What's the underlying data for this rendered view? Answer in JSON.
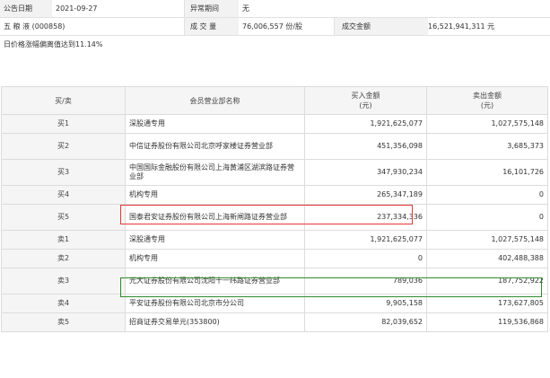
{
  "info": {
    "announce_date_label": "公告日期",
    "announce_date": "2021-09-27",
    "abnormal_period_label": "异常期间",
    "abnormal_period": "无",
    "stock_name": "五 粮 液 (000858)",
    "volume_label": "成 交 量",
    "volume": "76,006,557 份/股",
    "turnover_label": "成交金额",
    "turnover": "16,521,941,311 元",
    "reason": "日价格涨幅偏离值达到11.14%"
  },
  "table": {
    "headers": {
      "direction": "买/卖",
      "member": "会员营业部名称",
      "buy": "买入金额\n(元)",
      "sell": "卖出金额\n(元)"
    },
    "rows": [
      {
        "direction": "买1",
        "member": "深股通专用",
        "buy": "1,921,625,077",
        "sell": "1,027,575,148"
      },
      {
        "direction": "买2",
        "member": "中信证券股份有限公司北京呼家楼证券营业部",
        "buy": "451,356,098",
        "sell": "3,685,373"
      },
      {
        "direction": "买3",
        "member": "中国国际金融股份有限公司上海黄浦区湖滨路证券营业部",
        "buy": "347,930,234",
        "sell": "16,101,726"
      },
      {
        "direction": "买4",
        "member": "机构专用",
        "buy": "265,347,189",
        "sell": "0"
      },
      {
        "direction": "买5",
        "member": "国泰君安证券股份有限公司上海新闸路证券营业部",
        "buy": "237,334,336",
        "sell": "0"
      },
      {
        "direction": "卖1",
        "member": "深股通专用",
        "buy": "1,921,625,077",
        "sell": "1,027,575,148"
      },
      {
        "direction": "卖2",
        "member": "机构专用",
        "buy": "0",
        "sell": "402,488,388"
      },
      {
        "direction": "卖3",
        "member": "光大证券股份有限公司沈阳十一纬路证券营业部",
        "buy": "789,036",
        "sell": "187,752,922"
      },
      {
        "direction": "卖4",
        "member": "平安证券股份有限公司北京市分公司",
        "buy": "9,905,158",
        "sell": "173,627,805"
      },
      {
        "direction": "卖5",
        "member": "招商证券交易单元(353800)",
        "buy": "82,039,652",
        "sell": "119,536,868"
      }
    ]
  },
  "colors": {
    "highlight_buy": "#e53935",
    "highlight_sell": "#2e8b2e"
  }
}
